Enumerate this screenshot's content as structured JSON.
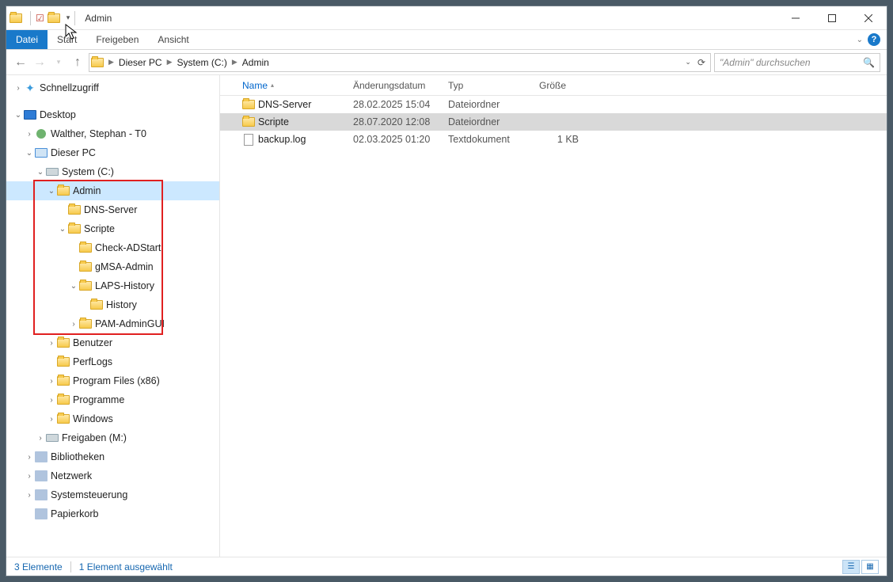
{
  "window_title": "Admin",
  "ribbon": {
    "file": "Datei",
    "tabs": [
      "Start",
      "Freigeben",
      "Ansicht"
    ]
  },
  "breadcrumbs": [
    "Dieser PC",
    "System (C:)",
    "Admin"
  ],
  "search_placeholder": "\"Admin\" durchsuchen",
  "columns": {
    "name": "Name",
    "date": "Änderungsdatum",
    "type": "Typ",
    "size": "Größe"
  },
  "items": [
    {
      "name": "DNS-Server",
      "date": "28.02.2025 15:04",
      "type": "Dateiordner",
      "size": "",
      "icon": "folder",
      "selected": false
    },
    {
      "name": "Scripte",
      "date": "28.07.2020 12:08",
      "type": "Dateiordner",
      "size": "",
      "icon": "folder",
      "selected": true
    },
    {
      "name": "backup.log",
      "date": "02.03.2025 01:20",
      "type": "Textdokument",
      "size": "1 KB",
      "icon": "file",
      "selected": false
    }
  ],
  "tree": [
    {
      "indent": 0,
      "expander": ">",
      "icon": "star",
      "label": "Schnellzugriff"
    },
    {
      "indent": 0,
      "expander": "v",
      "icon": "desktop",
      "label": "Desktop"
    },
    {
      "indent": 1,
      "expander": ">",
      "icon": "user",
      "label": "Walther, Stephan - T0"
    },
    {
      "indent": 1,
      "expander": "v",
      "icon": "pc",
      "label": "Dieser PC"
    },
    {
      "indent": 2,
      "expander": "v",
      "icon": "drive",
      "label": "System (C:)"
    },
    {
      "indent": 3,
      "expander": "v",
      "icon": "folder",
      "label": "Admin",
      "selected": true
    },
    {
      "indent": 4,
      "expander": "",
      "icon": "folder",
      "label": "DNS-Server"
    },
    {
      "indent": 4,
      "expander": "v",
      "icon": "folder",
      "label": "Scripte"
    },
    {
      "indent": 5,
      "expander": "",
      "icon": "folder",
      "label": "Check-ADStart"
    },
    {
      "indent": 5,
      "expander": "",
      "icon": "folder",
      "label": "gMSA-Admin"
    },
    {
      "indent": 5,
      "expander": "v",
      "icon": "folder",
      "label": "LAPS-History"
    },
    {
      "indent": 6,
      "expander": "",
      "icon": "folder",
      "label": "History"
    },
    {
      "indent": 5,
      "expander": ">",
      "icon": "folder",
      "label": "PAM-AdminGUI"
    },
    {
      "indent": 3,
      "expander": ">",
      "icon": "folder",
      "label": "Benutzer"
    },
    {
      "indent": 3,
      "expander": "",
      "icon": "folder",
      "label": "PerfLogs"
    },
    {
      "indent": 3,
      "expander": ">",
      "icon": "folder",
      "label": "Program Files (x86)"
    },
    {
      "indent": 3,
      "expander": ">",
      "icon": "folder",
      "label": "Programme"
    },
    {
      "indent": 3,
      "expander": ">",
      "icon": "folder",
      "label": "Windows"
    },
    {
      "indent": 2,
      "expander": ">",
      "icon": "drive",
      "label": "Freigaben (M:)"
    },
    {
      "indent": 1,
      "expander": ">",
      "icon": "lib",
      "label": "Bibliotheken"
    },
    {
      "indent": 1,
      "expander": ">",
      "icon": "net",
      "label": "Netzwerk"
    },
    {
      "indent": 1,
      "expander": ">",
      "icon": "ctrl",
      "label": "Systemsteuerung"
    },
    {
      "indent": 1,
      "expander": "",
      "icon": "bin",
      "label": "Papierkorb"
    }
  ],
  "highlight_box": {
    "top_row": 5,
    "bottom_row": 12
  },
  "status": {
    "count": "3 Elemente",
    "selected": "1 Element ausgewählt"
  }
}
